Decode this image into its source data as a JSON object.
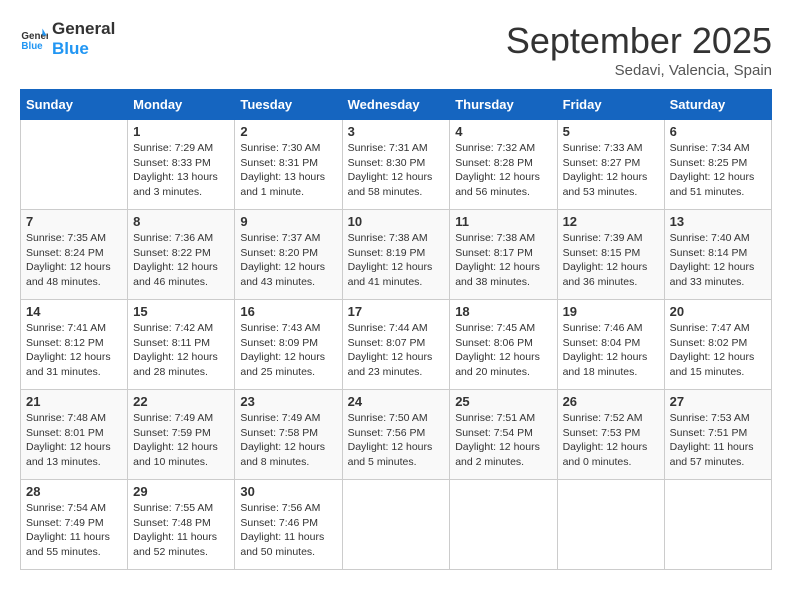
{
  "header": {
    "logo_general": "General",
    "logo_blue": "Blue",
    "month_title": "September 2025",
    "subtitle": "Sedavi, Valencia, Spain"
  },
  "weekdays": [
    "Sunday",
    "Monday",
    "Tuesday",
    "Wednesday",
    "Thursday",
    "Friday",
    "Saturday"
  ],
  "weeks": [
    [
      {
        "day": "",
        "info": ""
      },
      {
        "day": "1",
        "info": "Sunrise: 7:29 AM\nSunset: 8:33 PM\nDaylight: 13 hours\nand 3 minutes."
      },
      {
        "day": "2",
        "info": "Sunrise: 7:30 AM\nSunset: 8:31 PM\nDaylight: 13 hours\nand 1 minute."
      },
      {
        "day": "3",
        "info": "Sunrise: 7:31 AM\nSunset: 8:30 PM\nDaylight: 12 hours\nand 58 minutes."
      },
      {
        "day": "4",
        "info": "Sunrise: 7:32 AM\nSunset: 8:28 PM\nDaylight: 12 hours\nand 56 minutes."
      },
      {
        "day": "5",
        "info": "Sunrise: 7:33 AM\nSunset: 8:27 PM\nDaylight: 12 hours\nand 53 minutes."
      },
      {
        "day": "6",
        "info": "Sunrise: 7:34 AM\nSunset: 8:25 PM\nDaylight: 12 hours\nand 51 minutes."
      }
    ],
    [
      {
        "day": "7",
        "info": "Sunrise: 7:35 AM\nSunset: 8:24 PM\nDaylight: 12 hours\nand 48 minutes."
      },
      {
        "day": "8",
        "info": "Sunrise: 7:36 AM\nSunset: 8:22 PM\nDaylight: 12 hours\nand 46 minutes."
      },
      {
        "day": "9",
        "info": "Sunrise: 7:37 AM\nSunset: 8:20 PM\nDaylight: 12 hours\nand 43 minutes."
      },
      {
        "day": "10",
        "info": "Sunrise: 7:38 AM\nSunset: 8:19 PM\nDaylight: 12 hours\nand 41 minutes."
      },
      {
        "day": "11",
        "info": "Sunrise: 7:38 AM\nSunset: 8:17 PM\nDaylight: 12 hours\nand 38 minutes."
      },
      {
        "day": "12",
        "info": "Sunrise: 7:39 AM\nSunset: 8:15 PM\nDaylight: 12 hours\nand 36 minutes."
      },
      {
        "day": "13",
        "info": "Sunrise: 7:40 AM\nSunset: 8:14 PM\nDaylight: 12 hours\nand 33 minutes."
      }
    ],
    [
      {
        "day": "14",
        "info": "Sunrise: 7:41 AM\nSunset: 8:12 PM\nDaylight: 12 hours\nand 31 minutes."
      },
      {
        "day": "15",
        "info": "Sunrise: 7:42 AM\nSunset: 8:11 PM\nDaylight: 12 hours\nand 28 minutes."
      },
      {
        "day": "16",
        "info": "Sunrise: 7:43 AM\nSunset: 8:09 PM\nDaylight: 12 hours\nand 25 minutes."
      },
      {
        "day": "17",
        "info": "Sunrise: 7:44 AM\nSunset: 8:07 PM\nDaylight: 12 hours\nand 23 minutes."
      },
      {
        "day": "18",
        "info": "Sunrise: 7:45 AM\nSunset: 8:06 PM\nDaylight: 12 hours\nand 20 minutes."
      },
      {
        "day": "19",
        "info": "Sunrise: 7:46 AM\nSunset: 8:04 PM\nDaylight: 12 hours\nand 18 minutes."
      },
      {
        "day": "20",
        "info": "Sunrise: 7:47 AM\nSunset: 8:02 PM\nDaylight: 12 hours\nand 15 minutes."
      }
    ],
    [
      {
        "day": "21",
        "info": "Sunrise: 7:48 AM\nSunset: 8:01 PM\nDaylight: 12 hours\nand 13 minutes."
      },
      {
        "day": "22",
        "info": "Sunrise: 7:49 AM\nSunset: 7:59 PM\nDaylight: 12 hours\nand 10 minutes."
      },
      {
        "day": "23",
        "info": "Sunrise: 7:49 AM\nSunset: 7:58 PM\nDaylight: 12 hours\nand 8 minutes."
      },
      {
        "day": "24",
        "info": "Sunrise: 7:50 AM\nSunset: 7:56 PM\nDaylight: 12 hours\nand 5 minutes."
      },
      {
        "day": "25",
        "info": "Sunrise: 7:51 AM\nSunset: 7:54 PM\nDaylight: 12 hours\nand 2 minutes."
      },
      {
        "day": "26",
        "info": "Sunrise: 7:52 AM\nSunset: 7:53 PM\nDaylight: 12 hours\nand 0 minutes."
      },
      {
        "day": "27",
        "info": "Sunrise: 7:53 AM\nSunset: 7:51 PM\nDaylight: 11 hours\nand 57 minutes."
      }
    ],
    [
      {
        "day": "28",
        "info": "Sunrise: 7:54 AM\nSunset: 7:49 PM\nDaylight: 11 hours\nand 55 minutes."
      },
      {
        "day": "29",
        "info": "Sunrise: 7:55 AM\nSunset: 7:48 PM\nDaylight: 11 hours\nand 52 minutes."
      },
      {
        "day": "30",
        "info": "Sunrise: 7:56 AM\nSunset: 7:46 PM\nDaylight: 11 hours\nand 50 minutes."
      },
      {
        "day": "",
        "info": ""
      },
      {
        "day": "",
        "info": ""
      },
      {
        "day": "",
        "info": ""
      },
      {
        "day": "",
        "info": ""
      }
    ]
  ]
}
